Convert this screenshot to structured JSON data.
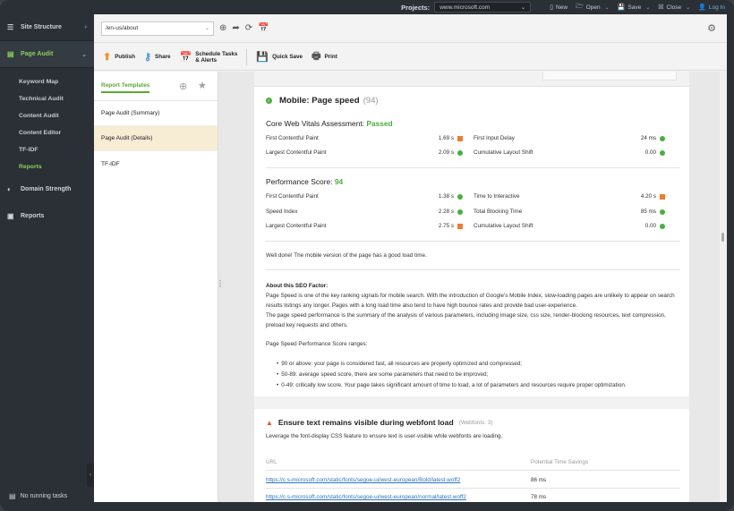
{
  "topbar": {
    "projects_label": "Projects:",
    "project_value": "www.microsoft.com",
    "new_label": "New",
    "open_label": "Open",
    "save_label": "Save",
    "close_label": "Close",
    "login_label": "Log In"
  },
  "leftnav": {
    "site_structure": "Site Structure",
    "page_audit": "Page Audit",
    "sub_items": [
      "Keyword Map",
      "Technical Audit",
      "Content Audit",
      "Content Editor",
      "TF-IDF",
      "Reports"
    ],
    "domain_strength": "Domain Strength",
    "reports": "Reports",
    "no_running_tasks": "No running tasks"
  },
  "addressbar": {
    "url": "/en-us/about"
  },
  "toolbar": {
    "publish": "Publish",
    "share": "Share",
    "schedule_line1": "Schedule Tasks",
    "schedule_line2": "& Alerts",
    "quick_save": "Quick Save",
    "print": "Print"
  },
  "templates": {
    "title": "Report Templates",
    "items": [
      "Page Audit (Summary)",
      "Page Audit (Details)",
      "TF-IDF"
    ]
  },
  "report": {
    "mobile_title": "Mobile: Page speed",
    "mobile_count": "(94)",
    "cwv_label": "Core Web Vitals Assessment:",
    "cwv_status": "Passed",
    "cwv_rows": [
      {
        "left_name": "First Contentful Paint",
        "left_value": "1.69 s",
        "right_name": "First Input Delay",
        "right_value": "24 ms"
      },
      {
        "left_name": "Largest Contentful Paint",
        "left_value": "2.09 s",
        "right_name": "Cumulative Layout Shift",
        "right_value": "0.00"
      }
    ],
    "perf_label": "Performance Score:",
    "perf_score": "94",
    "perf_rows": [
      {
        "left_name": "First Contentful Paint",
        "left_value": "1.38 s",
        "right_name": "Time to Interactive",
        "right_value": "4.20 s"
      },
      {
        "left_name": "Speed Index",
        "left_value": "2.28 s",
        "right_name": "Total Blocking Time",
        "right_value": "85 ms"
      },
      {
        "left_name": "Largest Contentful Paint",
        "left_value": "2.75 s",
        "right_name": "Cumulative Layout Shift",
        "right_value": "0.00"
      }
    ],
    "good_msg": "Well done! The mobile version of the page has a good load time.",
    "about_title": "About this SEO Factor:",
    "about_p1": "Page Speed is one of the key ranking signals for mobile search. With the introduction of Google's Mobile Index, slow-loading pages are unlikely to appear on search results listings any longer. Pages with a long load time also tend to have high bounce rates and provide bad user-experience.",
    "about_p2": "The page speed performance is the summary of the analysis of various parameters, including image size, css size, render-blocking resources, text compression, preload key requests and others.",
    "ranges_title": "Page Speed Performance Score ranges:",
    "ranges": [
      "90 or above: your page is considered fast, all resources are properly optimized and compressed;",
      "50-89: average speed score, there are some parameters that need to be improved;",
      "0-49: critically low score. Your page takes significant amount of time to load, a lot of parameters and resources require proper optimization."
    ],
    "webfont_title": "Ensure text remains visible during webfont load",
    "webfont_count": "(Webfonts: 3)",
    "webfont_desc": "Leverage the font-display CSS feature to ensure text is user-visible while webfonts are loading.",
    "col_url": "URL",
    "col_savings": "Potential Time Savings",
    "webfont_rows": [
      {
        "url": "https://c.s-microsoft.com/static/fonts/segoe-ui/west-european/Bold/latest.woff2",
        "savings": "86 ms"
      },
      {
        "url": "https://c.s-microsoft.com/static/fonts/segoe-ui/west-european/normal/latest.woff2",
        "savings": "78 ms"
      }
    ]
  }
}
